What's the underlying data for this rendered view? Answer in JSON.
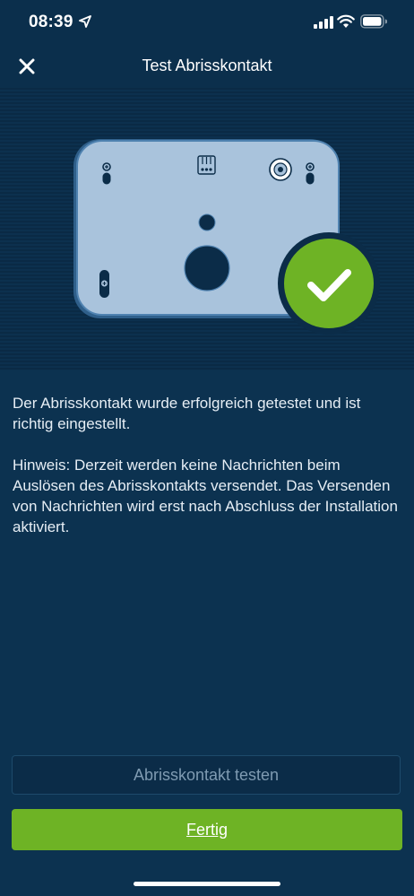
{
  "status_bar": {
    "time": "08:39",
    "icons": [
      "location-arrow-icon",
      "cellular-signal-icon",
      "wifi-icon",
      "battery-icon"
    ]
  },
  "nav": {
    "title": "Test Abrisskontakt",
    "close_icon": "close-icon"
  },
  "hero": {
    "illustration": "device-backplate-illustration",
    "status_icon": "check-circle-icon",
    "status_color": "#6eb325"
  },
  "content": {
    "message": "Der Abrisskontakt wurde erfolgreich getestet und ist richtig eingestellt.",
    "hint": "Hinweis: Derzeit werden keine Nachrichten beim Auslösen des Abrisskontakts versendet. Das Versenden von Nachrichten wird erst nach Abschluss der Installation aktiviert."
  },
  "buttons": {
    "test_label": "Abrisskontakt testen",
    "done_label": "Fertig"
  },
  "colors": {
    "background": "#0c3250",
    "accent_green": "#6eb325",
    "plate": "#a9c3dc"
  }
}
